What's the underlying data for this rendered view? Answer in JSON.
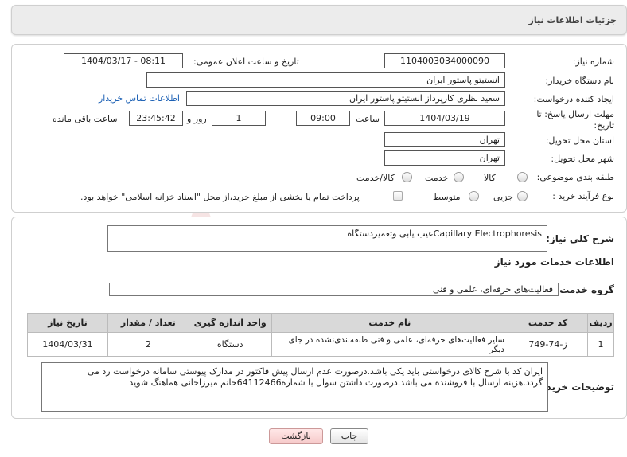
{
  "header": {
    "title": "جزئیات اطلاعات نیاز"
  },
  "form": {
    "need_number_label": "شماره نیاز:",
    "need_number": "1104003034000090",
    "announce_label": "تاریخ و ساعت اعلان عمومی:",
    "announce_value": "1404/03/17 - 08:11",
    "buyer_org_label": "نام دستگاه خریدار:",
    "buyer_org": "انستیتو پاستور ایران",
    "creator_label": "ایجاد کننده درخواست:",
    "creator": "سعید نظری کارپرداز انستیتو پاستور ایران",
    "contact_link": "اطلاعات تماس خریدار",
    "deadline_label_line1": "مهلت ارسال پاسخ: تا",
    "deadline_label_line2": "تاریخ:",
    "deadline_date": "1404/03/19",
    "time_label": "ساعت",
    "deadline_time": "09:00",
    "days": "1",
    "days_label": "روز و",
    "remaining_time": "23:45:42",
    "remaining_label": "ساعت باقی مانده",
    "province_label": "استان محل تحویل:",
    "province": "تهران",
    "city_label": "شهر محل تحویل:",
    "city": "تهران",
    "category_label": "طبقه بندی موضوعی:",
    "category_options": [
      "کالا",
      "خدمت",
      "کالا/خدمت"
    ],
    "process_label": "نوع فرآیند خرید :",
    "process_options": [
      "جزیی",
      "متوسط"
    ],
    "treasury_note": "پرداخت تمام یا بخشی از مبلغ خرید،از محل \"اسناد خزانه اسلامی\" خواهد بود."
  },
  "summary": {
    "label": "شرح کلی نیاز:",
    "text": "عیب یابی وتعمیردستگاهCapillary Electrophoresis"
  },
  "services": {
    "section_title": "اطلاعات خدمات مورد نیاز",
    "group_label": "گروه خدمت:",
    "group_value": "فعالیت‌های حرفه‌ای، علمی و فنی",
    "columns": [
      "ردیف",
      "کد خدمت",
      "نام خدمت",
      "واحد اندازه گیری",
      "تعداد / مقدار",
      "تاریخ نیاز"
    ],
    "rows": [
      {
        "index": "1",
        "code": "ز-74-749",
        "name": "سایر فعالیت‌های حرفه‌ای، علمی و فنی طبقه‌بندی‌نشده در جای دیگر",
        "unit": "دستگاه",
        "qty": "2",
        "date": "1404/03/31"
      }
    ]
  },
  "buyer_notes": {
    "label": "توضیحات خریدار:",
    "text": "ایران کد با شرح کالای درخواستی باید یکی باشد.درصورت عدم ارسال پیش فاکتور در مدارک پیوستی سامانه درخواست رد می گردد.هزینه ارسال با فروشنده می باشد.درصورت داشتن سوال با شماره64112466خانم میرزاخانی هماهنگ شوید"
  },
  "actions": {
    "print": "چاپ",
    "back": "بازگشت"
  },
  "watermark": "AriaTender.neT"
}
